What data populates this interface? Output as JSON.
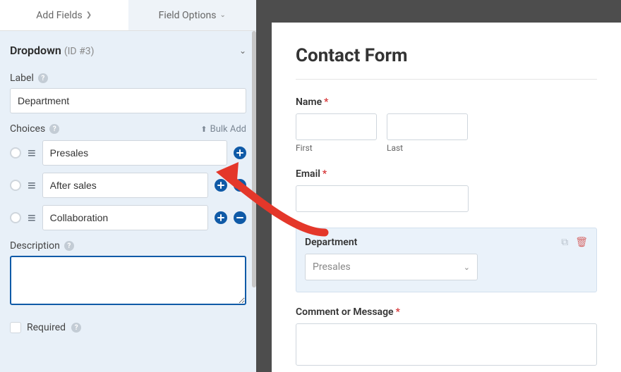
{
  "tabs": {
    "add_fields": "Add Fields",
    "field_options": "Field Options"
  },
  "section": {
    "type_label": "Dropdown",
    "id_text": "(ID #3)"
  },
  "label_block": {
    "title": "Label",
    "value": "Department"
  },
  "choices_block": {
    "title": "Choices",
    "bulk_add": "Bulk Add",
    "items": [
      "Presales",
      "After sales",
      "Collaboration"
    ]
  },
  "description_block": {
    "title": "Description",
    "value": ""
  },
  "required": {
    "label": "Required"
  },
  "preview": {
    "form_title": "Contact Form",
    "name": {
      "label": "Name",
      "first": "First",
      "last": "Last"
    },
    "email": {
      "label": "Email"
    },
    "department": {
      "label": "Department",
      "placeholder": "Presales"
    },
    "comment": {
      "label": "Comment or Message"
    }
  }
}
